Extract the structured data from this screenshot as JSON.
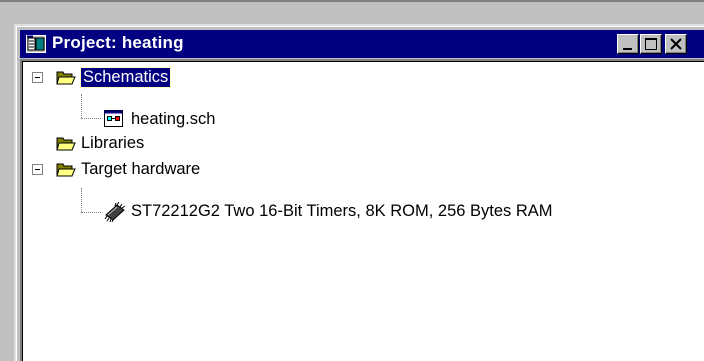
{
  "window": {
    "title": "Project: heating"
  },
  "tree": {
    "items": [
      {
        "label": "Schematics",
        "icon": "folder-open-icon",
        "expanded": true,
        "selected": true
      },
      {
        "label": "heating.sch",
        "icon": "schematic-file-icon"
      },
      {
        "label": "Libraries",
        "icon": "folder-open-icon"
      },
      {
        "label": "Target hardware",
        "icon": "folder-open-icon",
        "expanded": true
      },
      {
        "label": "ST72212G2  Two 16-Bit Timers, 8K ROM, 256 Bytes RAM",
        "icon": "chip-icon"
      }
    ]
  },
  "colors": {
    "titlebar": "#000080",
    "selection": "#000080",
    "face": "#c0c0c0",
    "folder": "#ffff80"
  }
}
